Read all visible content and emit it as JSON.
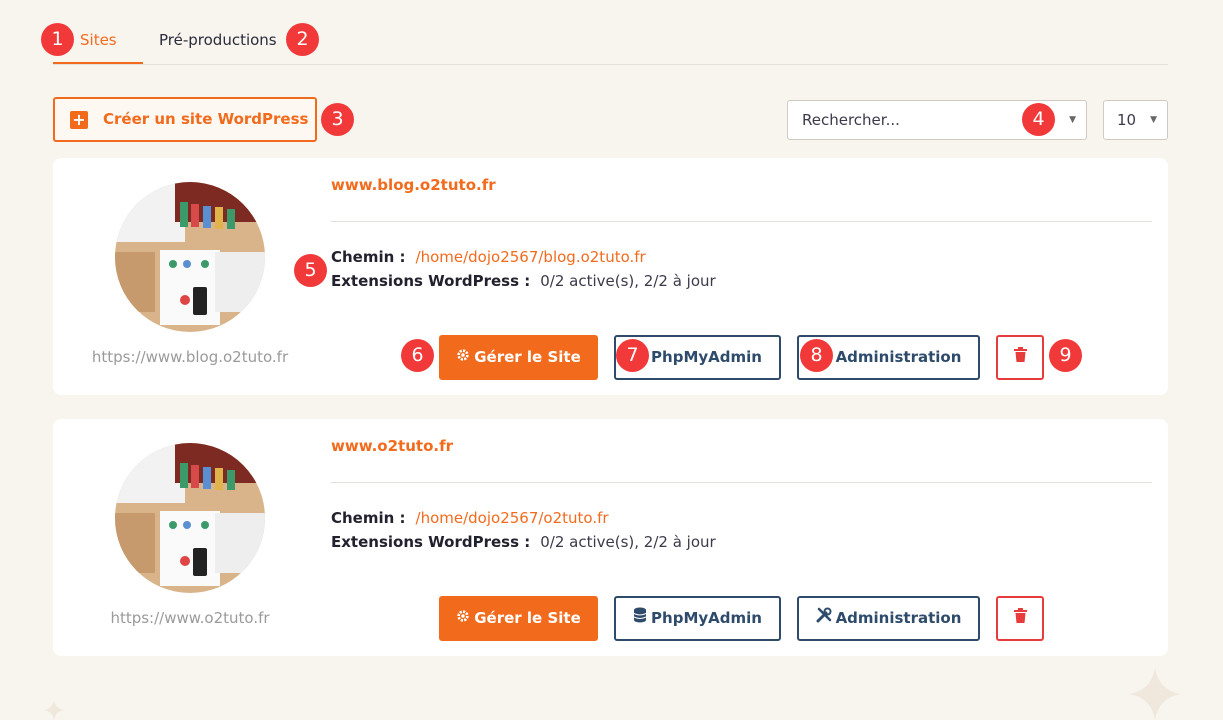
{
  "tabs": [
    {
      "label": "Sites",
      "active": true
    },
    {
      "label": "Pré-productions",
      "active": false
    }
  ],
  "toolbar": {
    "create_label": "Créer un site WordPress",
    "search_placeholder": "Rechercher...",
    "per_page": "10"
  },
  "markers": [
    "1",
    "2",
    "3",
    "4",
    "5",
    "6",
    "7",
    "8",
    "9"
  ],
  "labels": {
    "path": "Chemin :",
    "extensions": "Extensions WordPress :"
  },
  "sites": [
    {
      "domain": "www.blog.o2tuto.fr",
      "url": "https://www.blog.o2tuto.fr",
      "path": "/home/dojo2567/blog.o2tuto.fr",
      "extensions": "0/2 active(s), 2/2 à jour",
      "buttons": {
        "manage": "Gérer le Site",
        "pma": "PhpMyAdmin",
        "admin": "Administration"
      }
    },
    {
      "domain": "www.o2tuto.fr",
      "url": "https://www.o2tuto.fr",
      "path": "/home/dojo2567/o2tuto.fr",
      "extensions": "0/2 active(s), 2/2 à jour",
      "buttons": {
        "manage": "Gérer le Site",
        "pma": "PhpMyAdmin",
        "admin": "Administration"
      }
    }
  ],
  "colors": {
    "accent": "#f26b1d",
    "navy": "#2e4b6b",
    "danger": "#e83b3b",
    "marker": "#f2393a",
    "background": "#f8f4ee"
  }
}
